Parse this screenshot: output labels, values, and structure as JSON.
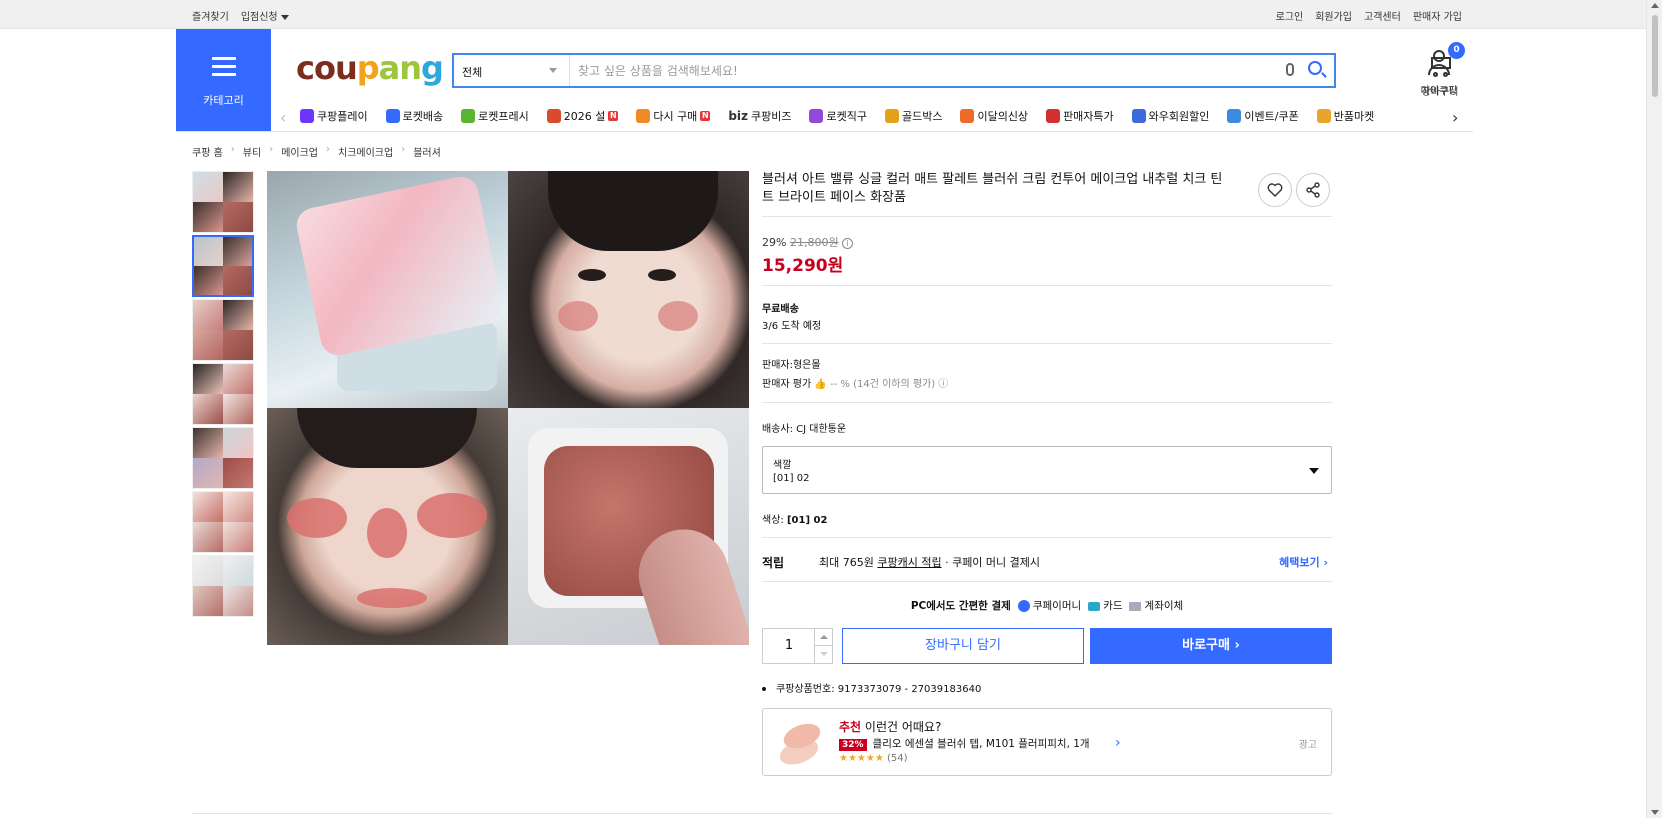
{
  "topbar": {
    "left": [
      "즐겨찾기",
      "입점신청"
    ],
    "right": [
      "로그인",
      "회원가입",
      "고객센터",
      "판매자 가입"
    ]
  },
  "category_label": "카테고리",
  "logo": {
    "parts": [
      "cou",
      "p",
      "an",
      "g"
    ]
  },
  "search": {
    "category": "전체",
    "placeholder": "찾고 싶은 상품을 검색해보세요!"
  },
  "header_links": {
    "my": "마이쿠팡",
    "cart": "장바구니",
    "cart_count": "0"
  },
  "quicknav": [
    {
      "label": "쿠팡플레이",
      "color": "#6b36ff"
    },
    {
      "label": "로켓배송",
      "color": "#346aff"
    },
    {
      "label": "로켓프레시",
      "color": "#5bb531"
    },
    {
      "label": "2026 설",
      "color": "#d94a2f",
      "badge": "N"
    },
    {
      "label": "다시 구매",
      "color": "#f08a24",
      "badge": "N"
    },
    {
      "label": "쿠팡비즈",
      "prefix": "biz",
      "color": "#333333"
    },
    {
      "label": "로켓직구",
      "color": "#8f4bd8"
    },
    {
      "label": "골드박스",
      "color": "#e3a21a"
    },
    {
      "label": "이달의신상",
      "color": "#ef6a2a"
    },
    {
      "label": "판매자특가",
      "color": "#d32f2f"
    },
    {
      "label": "와우회원할인",
      "color": "#3d6bdc"
    },
    {
      "label": "이벤트/쿠폰",
      "color": "#3d8be0"
    },
    {
      "label": "반품마켓",
      "color": "#e8a52a"
    }
  ],
  "breadcrumb": [
    "쿠팡 홈",
    "뷰티",
    "메이크업",
    "치크메이크업",
    "블러셔"
  ],
  "product": {
    "title": "블러셔 아트 밸류 싱글 컬러 매트 팔레트 블러쉬 크림 컨투어 메이크업 내추럴 치크 틴트 브라이트 페이스 화장품",
    "discount": "29%",
    "original_price": "21,800원",
    "final_price": "15,290원",
    "shipping_title": "무료배송",
    "arrival": "3/6 도착 예정",
    "seller": "판매자:형은몰",
    "seller_rating_label": "판매자 평가",
    "seller_rating_value": "-- % (14건 이하의 평가)",
    "carrier": "배송사:  CJ 대한통운",
    "option_label": "색깔",
    "option_value": "[01] 02",
    "color_label": "색상:",
    "color_value": "[01] 02",
    "reward_key": "적립",
    "reward_text_a": "최대 765원",
    "reward_text_link": "쿠팡캐시 적립",
    "reward_text_b": "· 쿠페이 머니 결제시",
    "reward_more": "혜택보기",
    "pay_title": "PC에서도 간편한 결제",
    "pay_methods": [
      "쿠페이머니",
      "카드",
      "계좌이체"
    ],
    "quantity": "1",
    "cart_button": "장바구니 담기",
    "buy_button": "바로구매",
    "product_id": "쿠팡상품번호: 9173373079 - 27039183640"
  },
  "recommend": {
    "head_red": "추천",
    "head": "이런건 어때요?",
    "discount": "32%",
    "name": "클리오 에센셜 블러쉬 텝, M101 플러피피치, 1개",
    "stars": "★★★★★",
    "count": "(54)",
    "ad": "광고"
  },
  "thumbnails": 7
}
